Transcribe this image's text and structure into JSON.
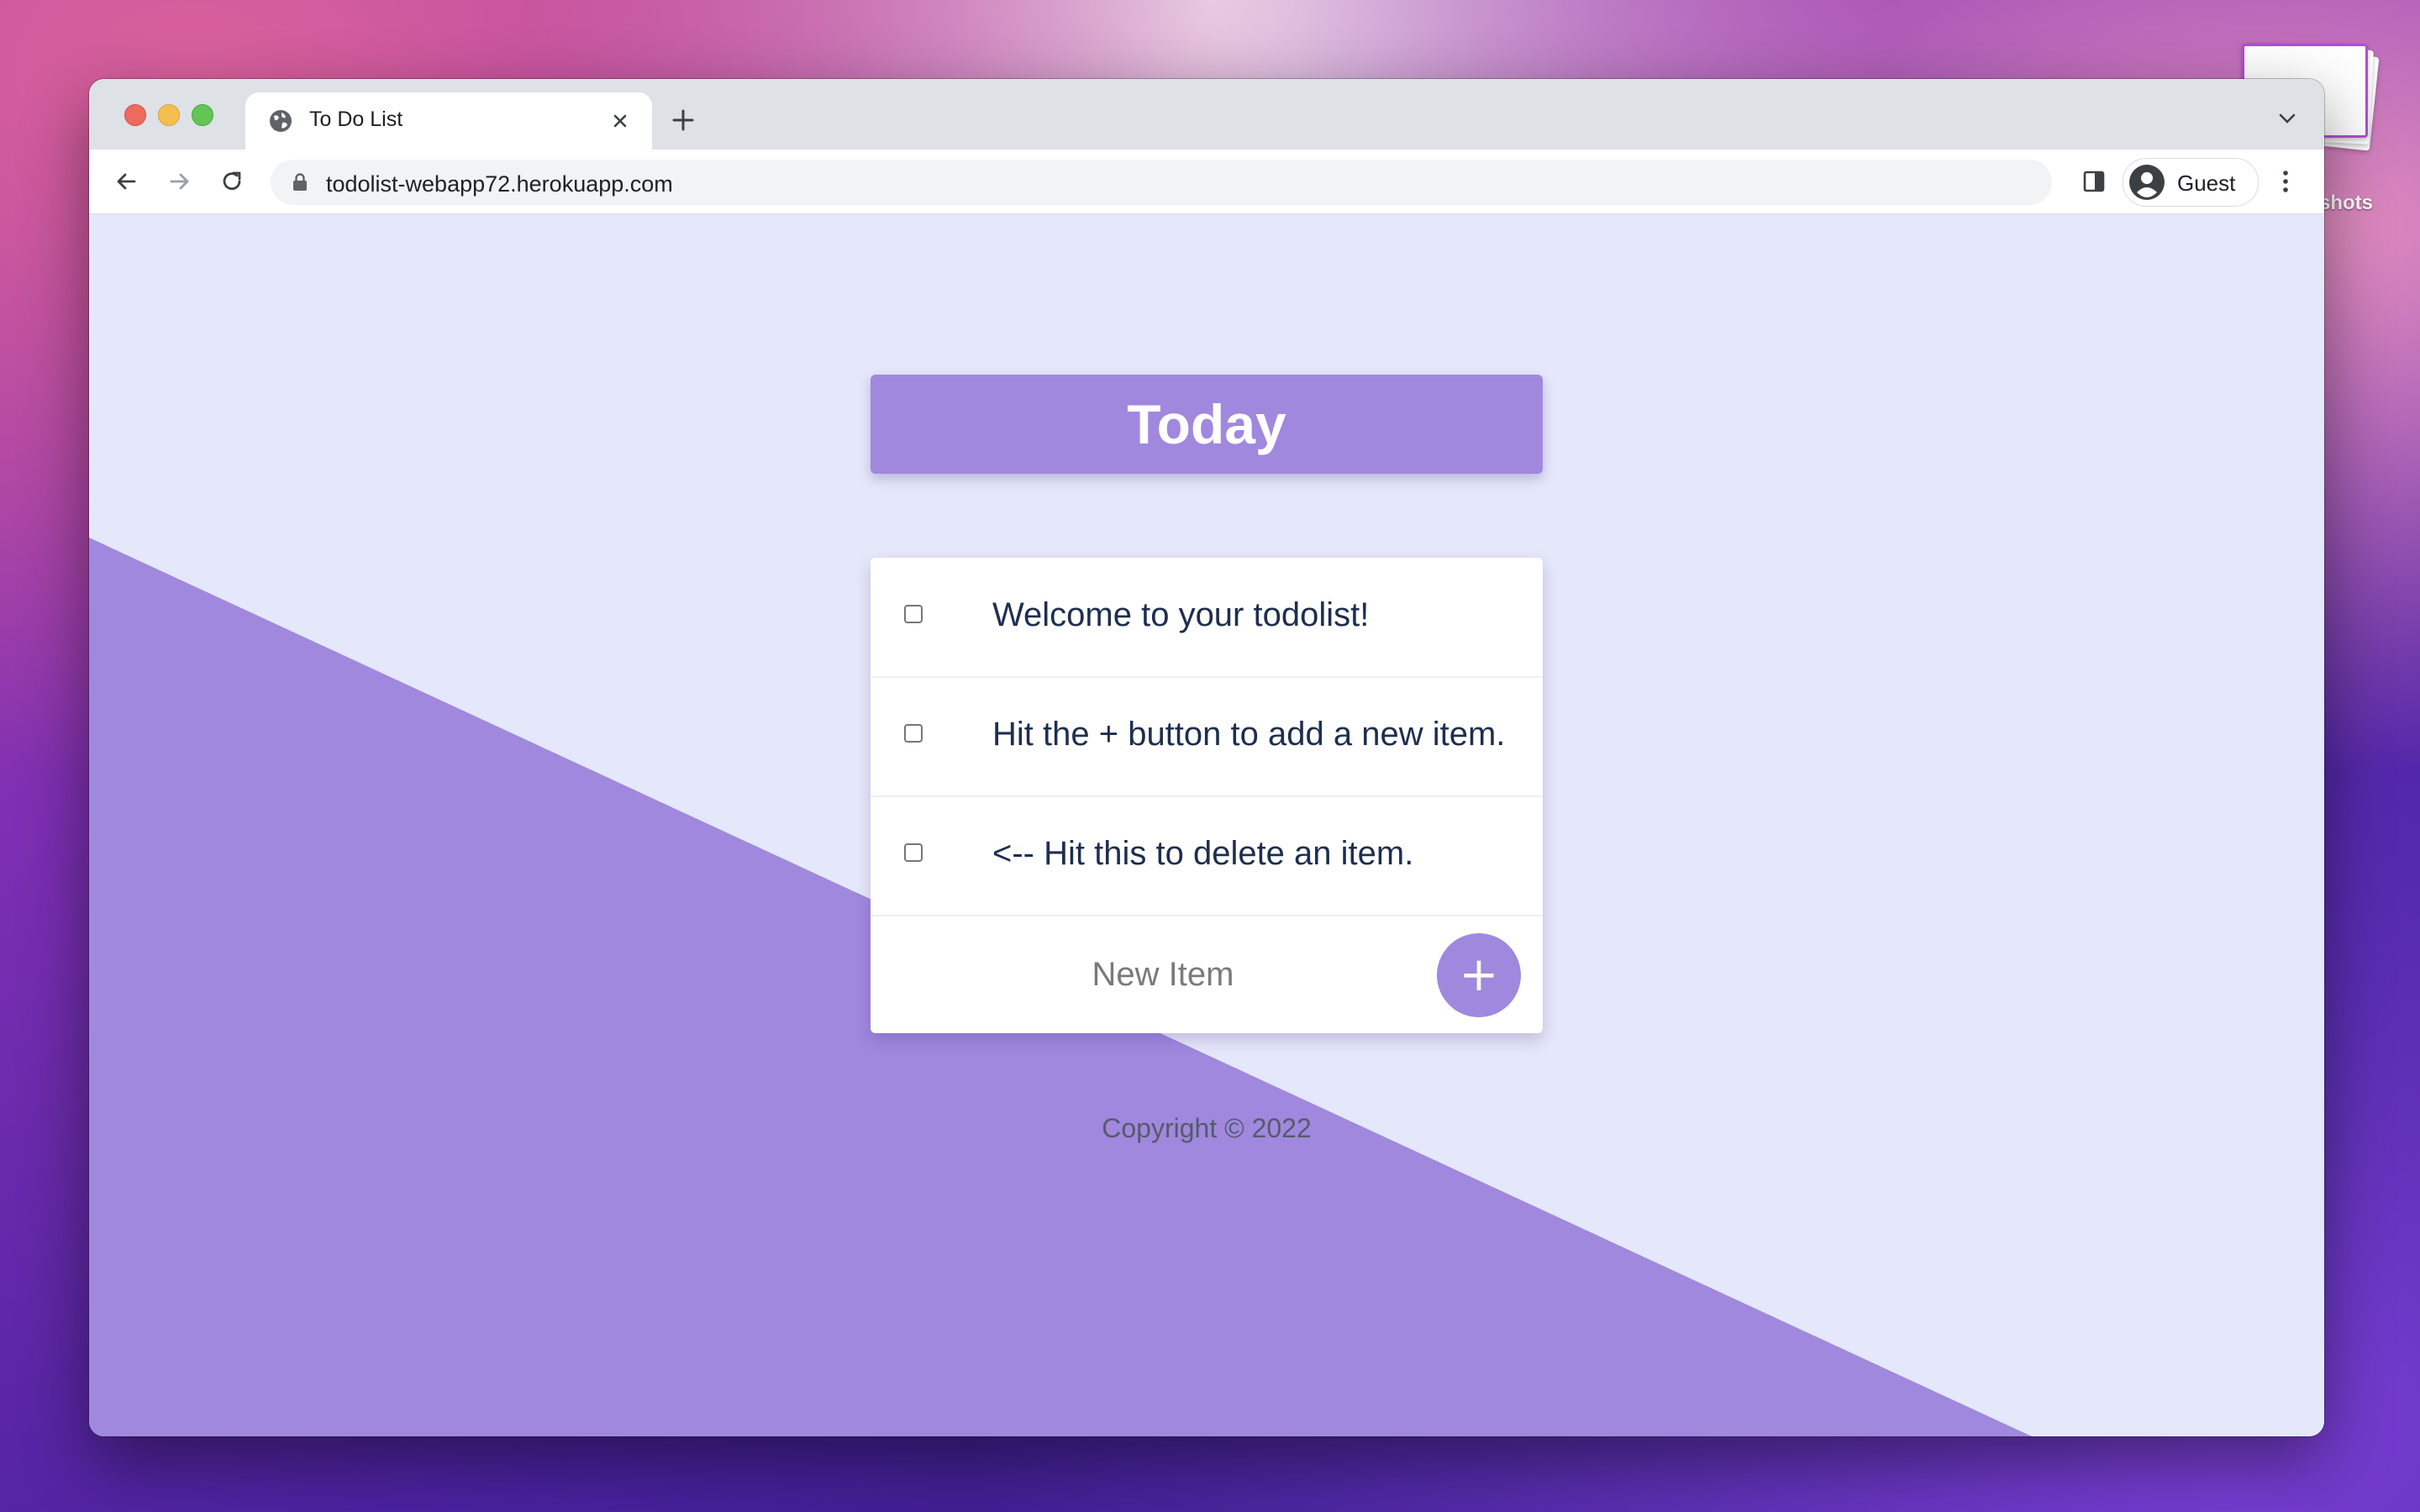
{
  "desktop": {
    "screenshots_label": "shots"
  },
  "browser": {
    "tab_title": "To Do List",
    "url": "todolist-webapp72.herokuapp.com",
    "profile_name": "Guest"
  },
  "page": {
    "heading": "Today",
    "items": [
      {
        "label": "Welcome to your todolist!",
        "checked": false
      },
      {
        "label": "Hit the + button to add a new item.",
        "checked": false
      },
      {
        "label": "<-- Hit this to delete an item.",
        "checked": false
      }
    ],
    "new_item_placeholder": "New Item",
    "add_button_label": "+",
    "footer": "Copyright © 2022"
  },
  "colors": {
    "accent": "#a088de",
    "page_background": "#e5e7fa",
    "item_text": "#1e2e4e"
  },
  "icons": [
    "globe-icon",
    "close-icon",
    "plus-icon",
    "chevron-down-icon",
    "back-arrow-icon",
    "forward-arrow-icon",
    "reload-icon",
    "lock-icon",
    "side-panel-icon",
    "profile-avatar-icon",
    "more-vert-icon"
  ]
}
